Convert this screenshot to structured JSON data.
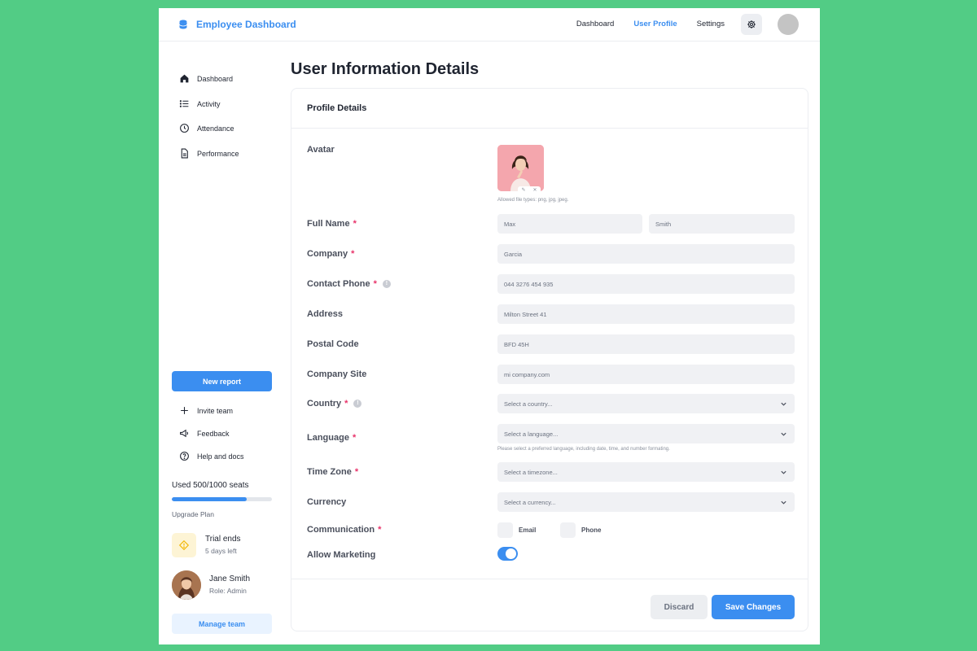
{
  "header": {
    "brand_title": "Employee Dashboard",
    "nav": [
      {
        "label": "Dashboard",
        "active": false
      },
      {
        "label": "User Profile",
        "active": true
      },
      {
        "label": "Settings",
        "active": false
      }
    ]
  },
  "sidebar": {
    "items": [
      {
        "label": "Dashboard",
        "icon": "home-icon"
      },
      {
        "label": "Activity",
        "icon": "list-icon"
      },
      {
        "label": "Attendance",
        "icon": "clock-icon"
      },
      {
        "label": "Performance",
        "icon": "document-icon"
      }
    ],
    "new_report_label": "New report",
    "links": [
      {
        "label": "Invite team",
        "icon": "plus-icon"
      },
      {
        "label": "Feedback",
        "icon": "megaphone-icon"
      },
      {
        "label": "Help and docs",
        "icon": "help-circle-icon"
      }
    ],
    "seats_label": "Used 500/1000 seats",
    "seats_used_fraction": 0.75,
    "upgrade_label": "Upgrade Plan",
    "trial_title": "Trial ends",
    "trial_sub": "5 days left",
    "user_name": "Jane Smith",
    "user_role": "Role: Admin",
    "manage_team_label": "Manage team"
  },
  "main": {
    "page_title": "User Information Details",
    "card_title": "Profile Details",
    "avatar_label": "Avatar",
    "avatar_hint": "Allowed file types: png, jpg, jpeg.",
    "fields": {
      "full_name": {
        "label": "Full Name",
        "first": "Max",
        "last": "Smith"
      },
      "company": {
        "label": "Company",
        "value": "Garcia"
      },
      "contact_phone": {
        "label": "Contact Phone",
        "value": "044 3276 454 935"
      },
      "address": {
        "label": "Address",
        "value": "Milton Street 41"
      },
      "postal_code": {
        "label": "Postal Code",
        "value": "BFD 45H"
      },
      "company_site": {
        "label": "Company Site",
        "value": "mi company.com"
      },
      "country": {
        "label": "Country",
        "placeholder": "Select a country..."
      },
      "language": {
        "label": "Language",
        "placeholder": "Select a language...",
        "hint": "Please select a preferred language, including date, time, and number formating."
      },
      "time_zone": {
        "label": "Time Zone",
        "placeholder": "Select a timezone..."
      },
      "currency": {
        "label": "Currency",
        "placeholder": "Select a currency..."
      },
      "communication": {
        "label": "Communication",
        "options": [
          "Email",
          "Phone"
        ]
      },
      "allow_marketing": {
        "label": "Allow Marketing",
        "enabled": true
      }
    },
    "discard_label": "Discard",
    "save_label": "Save Changes",
    "required_mark": "*",
    "info_mark": "!"
  },
  "colors": {
    "accent": "#3b8ef0",
    "background": "#52cc85",
    "required": "#e8336a"
  }
}
